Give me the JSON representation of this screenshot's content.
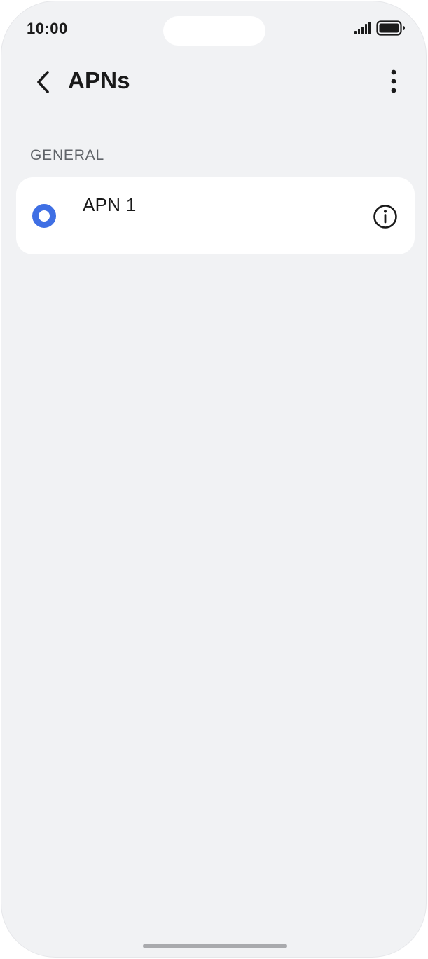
{
  "status_bar": {
    "time": "10:00",
    "signal_icon": "cellular-signal-icon",
    "battery_icon": "battery-full-icon"
  },
  "app_bar": {
    "back_icon": "chevron-left-icon",
    "title": "APNs",
    "more_icon": "more-vertical-icon"
  },
  "sections": [
    {
      "header": "GENERAL",
      "items": [
        {
          "name": "APN 1",
          "selected": true,
          "info_icon": "info-icon"
        }
      ]
    }
  ],
  "colors": {
    "accent": "#3f6fe4",
    "background": "#f1f2f4",
    "card": "#ffffff",
    "section_header": "#5f6368"
  }
}
